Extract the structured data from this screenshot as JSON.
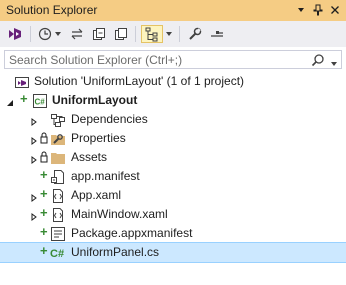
{
  "window": {
    "title": "Solution Explorer",
    "buttons": [
      "chevron-down-icon",
      "pin-icon",
      "close-icon"
    ]
  },
  "toolbar": {
    "tools": [
      {
        "name": "vs-switch-view-icon"
      },
      {
        "name": "back-icon"
      },
      {
        "name": "history-icon",
        "dropdown": true
      },
      {
        "name": "sync-icon"
      },
      {
        "name": "collapse-all-icon"
      },
      {
        "name": "show-all-files-icon"
      },
      {
        "name": "sync-active-document-icon",
        "active": true,
        "dropdown": true
      },
      {
        "name": "properties-wrench-icon"
      },
      {
        "name": "preview-icon"
      }
    ]
  },
  "search": {
    "placeholder": "Search Solution Explorer (Ctrl+;)"
  },
  "tree": {
    "solution_label": "Solution 'UniformLayout' (1 of 1 project)",
    "project_label": "UniformLayout",
    "items": [
      {
        "label": "Dependencies"
      },
      {
        "label": "Properties"
      },
      {
        "label": "Assets"
      },
      {
        "label": "app.manifest"
      },
      {
        "label": "App.xaml"
      },
      {
        "label": "MainWindow.xaml"
      },
      {
        "label": "Package.appxmanifest"
      },
      {
        "label": "UniformPanel.cs"
      }
    ]
  },
  "colors": {
    "title_bar": "#f5cc84",
    "toolbar": "#eeeef2",
    "selection": "#cce8ff",
    "added_green": "#388a34",
    "csharp_green": "#388a34",
    "folder": "#dcb67a"
  }
}
